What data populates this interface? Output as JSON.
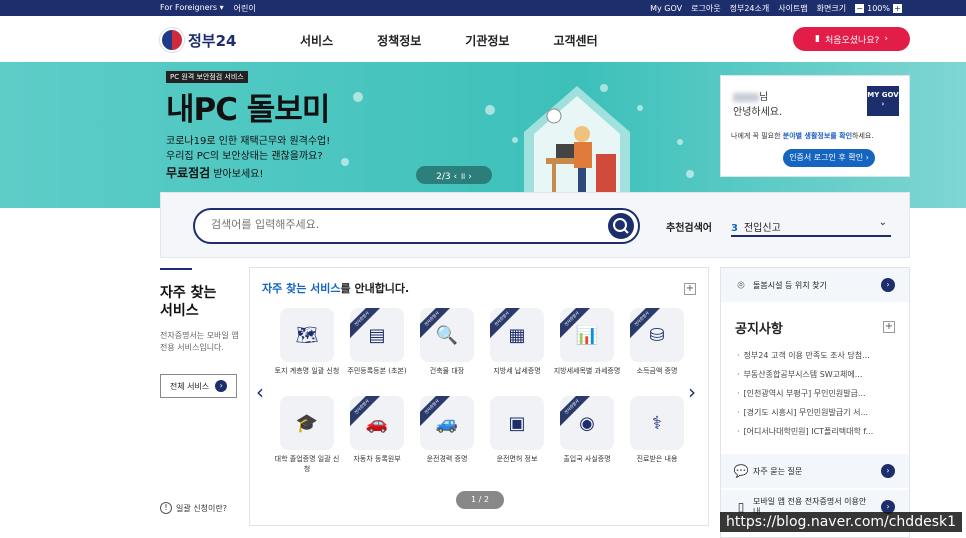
{
  "topbar": {
    "left": [
      "For Foreigners ▾",
      "어린이"
    ],
    "right": [
      "My GOV",
      "로그아웃",
      "정부24소개",
      "사이트맵",
      "화면크기"
    ],
    "zoom": "100%"
  },
  "header": {
    "logo": "정부24",
    "nav": [
      "서비스",
      "정책정보",
      "기관정보",
      "고객센터"
    ],
    "first_visit": "처음오셨나요?"
  },
  "banner": {
    "tag": "PC 원격 보안점검 서비스",
    "title": "내PC 돌보미",
    "line1": "코로나19로 인한 재택근무와 원격수업!",
    "line2": "우리집 PC의 보안상태는 괜찮을까요?",
    "line3_bold": "무료점검",
    "line3_rest": " 받아보세요!",
    "pager": "2/3  ‹  ॥  ›"
  },
  "login": {
    "suffix": "님",
    "hello": "안녕하세요.",
    "mygov": "MY GOV ›",
    "info_pre": "나에게 꼭 필요한 ",
    "info_hl": "분야별 생활정보를 확인",
    "info_post": "하세요.",
    "button": "인증서 로그인 후 확인 ›"
  },
  "search": {
    "placeholder": "검색어를 입력해주세요.",
    "rec_label": "추천검색어",
    "rec_num": "3",
    "rec_text": "전입신고"
  },
  "left": {
    "title1": "자주 찾는",
    "title2": "서비스",
    "desc": "전자증명서는 모바일 앱 전용 서비스입니다.",
    "all_button": "전체 서비스",
    "help": "일괄 신청이란?"
  },
  "services": {
    "title_hl": "자주 찾는 서비스",
    "title_rest": "를 안내합니다.",
    "items": [
      {
        "label": "토지 계층명 일괄 신청",
        "badge": false,
        "icon": "map-icon"
      },
      {
        "label": "주민등록등본 (초본)",
        "badge": true,
        "icon": "id-card-icon"
      },
      {
        "label": "건축물 대장",
        "badge": true,
        "icon": "document-search-icon"
      },
      {
        "label": "지방세 납세증명",
        "badge": true,
        "icon": "document-icon"
      },
      {
        "label": "지방세세목별 과세증명",
        "badge": true,
        "icon": "chart-board-icon"
      },
      {
        "label": "소득금액 증명",
        "badge": true,
        "icon": "coins-icon"
      },
      {
        "label": "대학 졸업증명 일괄 신청",
        "badge": false,
        "icon": "graduation-cap-icon"
      },
      {
        "label": "자동차 등록원부",
        "badge": true,
        "icon": "car-icon"
      },
      {
        "label": "운전경력 증명",
        "badge": true,
        "icon": "car-document-icon"
      },
      {
        "label": "운전면허 정보",
        "badge": false,
        "icon": "license-icon"
      },
      {
        "label": "출입국 사실증명",
        "badge": true,
        "icon": "passport-icon"
      },
      {
        "label": "진료받은 내용",
        "badge": false,
        "icon": "stethoscope-icon"
      }
    ],
    "badge_text": "전자증명서",
    "pager": "1 / 2"
  },
  "right": {
    "facility": "돌봄시설 등 위치 찾기",
    "notice_title": "공지사항",
    "notices": [
      "정부24 고객 이용 만족도 조사 당첨...",
      "부동산종합공부시스템 SW고체에...",
      "[인천광역시 부평구] 무인민원발급...",
      "[경기도 시흥시] 무인민원발급기 서...",
      "[어디서나대학민원] ICT폴리텍대학 f..."
    ],
    "faq": "자주 묻는 질문",
    "mobile": "모바일 앱 전용 전자증명서 이용안내"
  },
  "watermark": "https://blog.naver.com/chddesk1",
  "colors": {
    "navy": "#1c2e6b",
    "teal": "#3dc0ba",
    "red": "#e11d48",
    "blue": "#1565c0"
  }
}
